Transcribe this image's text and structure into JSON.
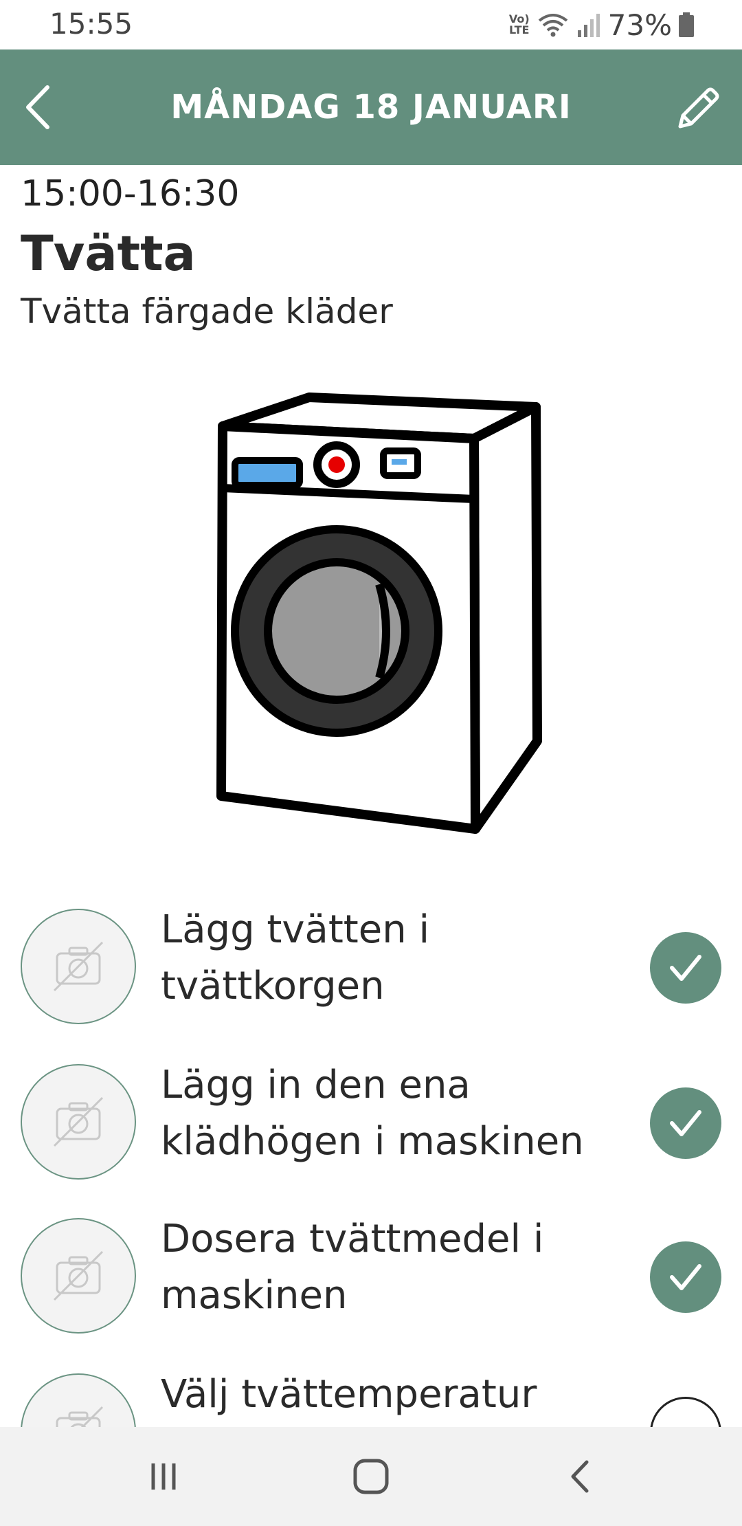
{
  "status_bar": {
    "time": "15:55",
    "volte_line1": "Vo)",
    "volte_line2": "LTE",
    "battery": "73%",
    "icons": [
      "volte-icon",
      "wifi-icon",
      "signal-icon",
      "battery-icon"
    ]
  },
  "header": {
    "title": "MÅNDAG 18 JANUARI",
    "background_color": "#638f7e",
    "back_icon": "chevron-left-icon",
    "edit_icon": "pencil-icon"
  },
  "activity": {
    "time_range": "15:00-16:30",
    "title": "Tvätta",
    "description": "Tvätta färgade kläder",
    "illustration": "washing-machine"
  },
  "steps": [
    {
      "text": "Lägg tvätten i tvättkorgen",
      "completed": true,
      "photo_icon": "no-photo-icon"
    },
    {
      "text": "Lägg in den ena klädhögen i maskinen",
      "completed": true,
      "photo_icon": "no-photo-icon"
    },
    {
      "text": "Dosera tvättmedel i maskinen",
      "completed": true,
      "photo_icon": "no-photo-icon"
    },
    {
      "text": "Välj tvättemperatur",
      "completed": false,
      "photo_icon": "no-photo-icon"
    }
  ],
  "nav_bar": {
    "icons": [
      "recent-apps-icon",
      "home-icon",
      "back-icon"
    ]
  },
  "colors": {
    "accent": "#638f7e",
    "text": "#2a2a2a"
  }
}
